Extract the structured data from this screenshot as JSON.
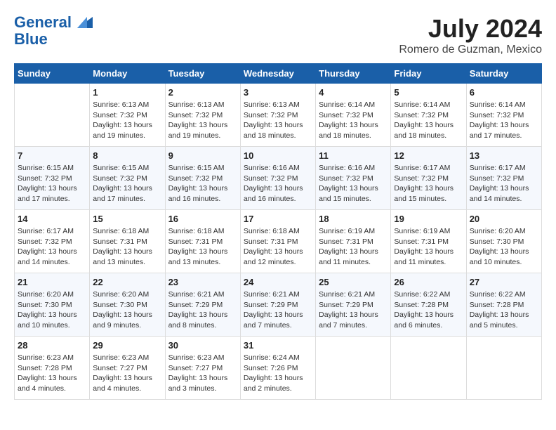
{
  "header": {
    "logo_line1": "General",
    "logo_line2": "Blue",
    "month_title": "July 2024",
    "location": "Romero de Guzman, Mexico"
  },
  "days_of_week": [
    "Sunday",
    "Monday",
    "Tuesday",
    "Wednesday",
    "Thursday",
    "Friday",
    "Saturday"
  ],
  "weeks": [
    [
      {
        "day": "",
        "sunrise": "",
        "sunset": "",
        "daylight": ""
      },
      {
        "day": "1",
        "sunrise": "Sunrise: 6:13 AM",
        "sunset": "Sunset: 7:32 PM",
        "daylight": "Daylight: 13 hours and 19 minutes."
      },
      {
        "day": "2",
        "sunrise": "Sunrise: 6:13 AM",
        "sunset": "Sunset: 7:32 PM",
        "daylight": "Daylight: 13 hours and 19 minutes."
      },
      {
        "day": "3",
        "sunrise": "Sunrise: 6:13 AM",
        "sunset": "Sunset: 7:32 PM",
        "daylight": "Daylight: 13 hours and 18 minutes."
      },
      {
        "day": "4",
        "sunrise": "Sunrise: 6:14 AM",
        "sunset": "Sunset: 7:32 PM",
        "daylight": "Daylight: 13 hours and 18 minutes."
      },
      {
        "day": "5",
        "sunrise": "Sunrise: 6:14 AM",
        "sunset": "Sunset: 7:32 PM",
        "daylight": "Daylight: 13 hours and 18 minutes."
      },
      {
        "day": "6",
        "sunrise": "Sunrise: 6:14 AM",
        "sunset": "Sunset: 7:32 PM",
        "daylight": "Daylight: 13 hours and 17 minutes."
      }
    ],
    [
      {
        "day": "7",
        "sunrise": "Sunrise: 6:15 AM",
        "sunset": "Sunset: 7:32 PM",
        "daylight": "Daylight: 13 hours and 17 minutes."
      },
      {
        "day": "8",
        "sunrise": "Sunrise: 6:15 AM",
        "sunset": "Sunset: 7:32 PM",
        "daylight": "Daylight: 13 hours and 17 minutes."
      },
      {
        "day": "9",
        "sunrise": "Sunrise: 6:15 AM",
        "sunset": "Sunset: 7:32 PM",
        "daylight": "Daylight: 13 hours and 16 minutes."
      },
      {
        "day": "10",
        "sunrise": "Sunrise: 6:16 AM",
        "sunset": "Sunset: 7:32 PM",
        "daylight": "Daylight: 13 hours and 16 minutes."
      },
      {
        "day": "11",
        "sunrise": "Sunrise: 6:16 AM",
        "sunset": "Sunset: 7:32 PM",
        "daylight": "Daylight: 13 hours and 15 minutes."
      },
      {
        "day": "12",
        "sunrise": "Sunrise: 6:17 AM",
        "sunset": "Sunset: 7:32 PM",
        "daylight": "Daylight: 13 hours and 15 minutes."
      },
      {
        "day": "13",
        "sunrise": "Sunrise: 6:17 AM",
        "sunset": "Sunset: 7:32 PM",
        "daylight": "Daylight: 13 hours and 14 minutes."
      }
    ],
    [
      {
        "day": "14",
        "sunrise": "Sunrise: 6:17 AM",
        "sunset": "Sunset: 7:32 PM",
        "daylight": "Daylight: 13 hours and 14 minutes."
      },
      {
        "day": "15",
        "sunrise": "Sunrise: 6:18 AM",
        "sunset": "Sunset: 7:31 PM",
        "daylight": "Daylight: 13 hours and 13 minutes."
      },
      {
        "day": "16",
        "sunrise": "Sunrise: 6:18 AM",
        "sunset": "Sunset: 7:31 PM",
        "daylight": "Daylight: 13 hours and 13 minutes."
      },
      {
        "day": "17",
        "sunrise": "Sunrise: 6:18 AM",
        "sunset": "Sunset: 7:31 PM",
        "daylight": "Daylight: 13 hours and 12 minutes."
      },
      {
        "day": "18",
        "sunrise": "Sunrise: 6:19 AM",
        "sunset": "Sunset: 7:31 PM",
        "daylight": "Daylight: 13 hours and 11 minutes."
      },
      {
        "day": "19",
        "sunrise": "Sunrise: 6:19 AM",
        "sunset": "Sunset: 7:31 PM",
        "daylight": "Daylight: 13 hours and 11 minutes."
      },
      {
        "day": "20",
        "sunrise": "Sunrise: 6:20 AM",
        "sunset": "Sunset: 7:30 PM",
        "daylight": "Daylight: 13 hours and 10 minutes."
      }
    ],
    [
      {
        "day": "21",
        "sunrise": "Sunrise: 6:20 AM",
        "sunset": "Sunset: 7:30 PM",
        "daylight": "Daylight: 13 hours and 10 minutes."
      },
      {
        "day": "22",
        "sunrise": "Sunrise: 6:20 AM",
        "sunset": "Sunset: 7:30 PM",
        "daylight": "Daylight: 13 hours and 9 minutes."
      },
      {
        "day": "23",
        "sunrise": "Sunrise: 6:21 AM",
        "sunset": "Sunset: 7:29 PM",
        "daylight": "Daylight: 13 hours and 8 minutes."
      },
      {
        "day": "24",
        "sunrise": "Sunrise: 6:21 AM",
        "sunset": "Sunset: 7:29 PM",
        "daylight": "Daylight: 13 hours and 7 minutes."
      },
      {
        "day": "25",
        "sunrise": "Sunrise: 6:21 AM",
        "sunset": "Sunset: 7:29 PM",
        "daylight": "Daylight: 13 hours and 7 minutes."
      },
      {
        "day": "26",
        "sunrise": "Sunrise: 6:22 AM",
        "sunset": "Sunset: 7:28 PM",
        "daylight": "Daylight: 13 hours and 6 minutes."
      },
      {
        "day": "27",
        "sunrise": "Sunrise: 6:22 AM",
        "sunset": "Sunset: 7:28 PM",
        "daylight": "Daylight: 13 hours and 5 minutes."
      }
    ],
    [
      {
        "day": "28",
        "sunrise": "Sunrise: 6:23 AM",
        "sunset": "Sunset: 7:28 PM",
        "daylight": "Daylight: 13 hours and 4 minutes."
      },
      {
        "day": "29",
        "sunrise": "Sunrise: 6:23 AM",
        "sunset": "Sunset: 7:27 PM",
        "daylight": "Daylight: 13 hours and 4 minutes."
      },
      {
        "day": "30",
        "sunrise": "Sunrise: 6:23 AM",
        "sunset": "Sunset: 7:27 PM",
        "daylight": "Daylight: 13 hours and 3 minutes."
      },
      {
        "day": "31",
        "sunrise": "Sunrise: 6:24 AM",
        "sunset": "Sunset: 7:26 PM",
        "daylight": "Daylight: 13 hours and 2 minutes."
      },
      {
        "day": "",
        "sunrise": "",
        "sunset": "",
        "daylight": ""
      },
      {
        "day": "",
        "sunrise": "",
        "sunset": "",
        "daylight": ""
      },
      {
        "day": "",
        "sunrise": "",
        "sunset": "",
        "daylight": ""
      }
    ]
  ]
}
